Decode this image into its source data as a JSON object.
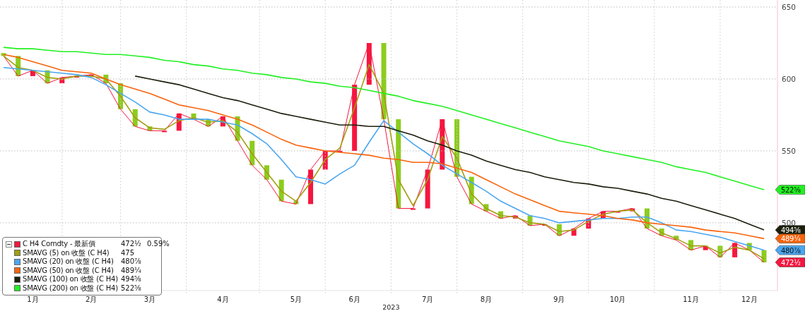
{
  "chart": {
    "chart_data": {
      "type": "line",
      "categories": [
        null,
        null,
        "1月",
        null,
        null,
        null,
        "2月",
        null,
        null,
        null,
        "3月",
        null,
        null,
        null,
        null,
        "4月",
        null,
        null,
        null,
        null,
        "5月",
        null,
        null,
        null,
        "6月",
        null,
        null,
        null,
        null,
        "7月",
        null,
        null,
        null,
        "8月",
        null,
        null,
        null,
        null,
        "9月",
        null,
        null,
        null,
        "10月",
        null,
        null,
        null,
        null,
        "11月",
        null,
        null,
        null,
        "12月",
        null
      ],
      "ylim": [
        452.9,
        654.9
      ],
      "grid": true,
      "xlabel": "2023",
      "yticks": [
        500,
        550,
        600,
        650
      ],
      "series": [
        {
          "name": "C H4 Comdty - 最新價",
          "color": "#f5163f",
          "values": [
            616,
            602,
            606,
            597,
            601,
            602,
            603,
            597,
            579,
            567,
            564,
            564,
            576,
            572,
            567,
            574,
            557,
            540,
            530,
            515,
            513,
            537,
            550,
            550,
            596,
            625,
            572,
            510,
            510,
            537,
            572,
            532,
            513,
            508,
            503,
            505,
            498,
            499,
            491,
            496,
            503,
            508,
            508,
            510,
            496,
            491,
            488,
            481,
            484,
            476,
            486,
            481,
            472.5
          ]
        },
        {
          "name": "SMAVG (5)  on 收盤 (C H4)",
          "color": "#a39e12",
          "values": [
            616,
            608,
            606,
            601,
            600,
            602,
            602,
            600,
            588,
            573,
            566,
            565,
            571,
            573,
            570,
            571,
            563,
            548,
            535,
            522,
            515,
            528,
            544,
            552,
            580,
            610,
            590,
            530,
            512,
            530,
            560,
            545,
            520,
            510,
            505,
            504,
            500,
            499,
            494,
            495,
            501,
            506,
            508,
            509,
            500,
            493,
            489,
            484,
            484,
            479,
            483,
            481,
            475
          ]
        },
        {
          "name": "SMAVG (20)  on 收盤 (C H4)",
          "color": "#4aa6f0",
          "values": [
            608,
            607,
            606,
            605,
            604,
            603,
            601,
            596,
            590,
            584,
            577,
            575,
            572,
            572,
            572,
            570,
            568,
            562,
            555,
            544,
            532,
            530,
            527,
            534,
            540,
            556,
            571,
            563,
            555,
            548,
            540,
            534,
            528,
            522,
            515,
            510,
            505,
            503,
            500,
            501,
            502,
            503,
            503,
            504,
            504,
            500,
            495,
            494,
            492,
            490,
            487,
            484,
            481
          ]
        },
        {
          "name": "SMAVG (50)  on 收盤 (C H4)",
          "color": "#f7630c",
          "values": [
            617,
            615,
            612,
            609,
            606,
            605,
            604,
            600,
            596,
            593,
            590,
            586,
            582,
            580,
            578,
            575,
            572,
            568,
            563,
            558,
            554,
            552,
            550,
            549,
            548,
            547,
            545,
            544,
            542,
            542,
            541,
            538,
            535,
            530,
            525,
            520,
            516,
            512,
            508,
            507,
            506,
            505,
            503,
            502,
            500,
            499,
            498,
            497,
            495,
            494,
            493,
            491,
            489
          ]
        },
        {
          "name": "SMAVG (100)  on 收盤 (C H4)",
          "color": "#1a1f0c",
          "values": [
            null,
            null,
            null,
            null,
            null,
            null,
            null,
            null,
            null,
            602,
            600,
            598,
            596,
            593,
            590,
            587,
            585,
            582,
            579,
            576,
            574,
            572,
            570,
            568,
            568,
            567,
            567,
            564,
            561,
            557,
            554,
            550,
            547,
            543,
            540,
            537,
            535,
            532,
            530,
            528,
            527,
            525,
            524,
            522,
            520,
            517,
            515,
            512,
            509,
            506,
            503,
            499,
            495
          ]
        },
        {
          "name": "SMAVG (200)  on 收盤 (C H4)",
          "color": "#22f022",
          "values": [
            622,
            621,
            621,
            620,
            619,
            619,
            618,
            617,
            617,
            616,
            615,
            613,
            612,
            610,
            609,
            607,
            606,
            604,
            603,
            601,
            600,
            598,
            597,
            595,
            594,
            592,
            590,
            588,
            585,
            583,
            581,
            578,
            575,
            572,
            569,
            566,
            563,
            560,
            557,
            555,
            553,
            550,
            548,
            546,
            544,
            542,
            539,
            537,
            535,
            532,
            529,
            526,
            523
          ]
        }
      ]
    },
    "legend": [
      {
        "value": "472½",
        "change": "0.59%"
      },
      {
        "value": "475"
      },
      {
        "value": "480⅞"
      },
      {
        "value": "489¼"
      },
      {
        "value": "494⅝"
      },
      {
        "value": "522⅝"
      }
    ],
    "price_tags": [
      {
        "text": "522⅝",
        "color": "#22f022"
      },
      {
        "text": "494⅝",
        "color": "#1a1f0c"
      },
      {
        "text": "489¼",
        "color": "#f7630c"
      },
      {
        "text": "480⅞",
        "color": "#4aa6f0"
      },
      {
        "text": "472½",
        "color": "#f5163f"
      }
    ]
  }
}
